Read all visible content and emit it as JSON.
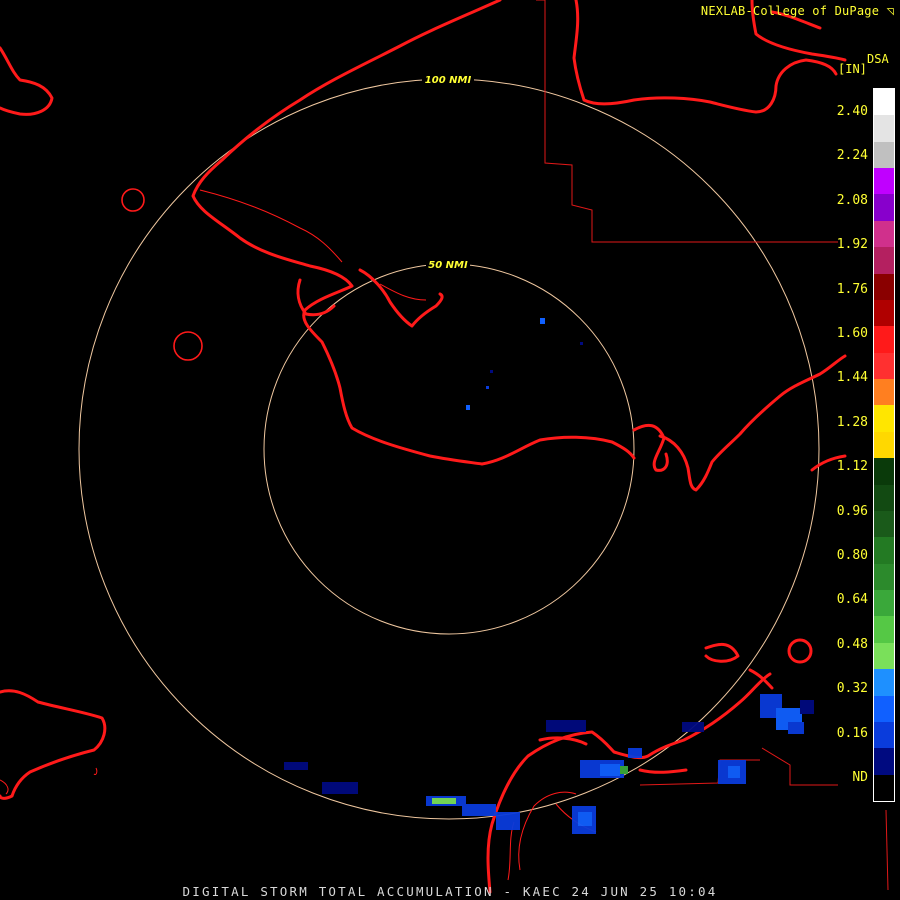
{
  "header": {
    "credit": "NEXLAB-College of DuPage",
    "credit_mark": "◹"
  },
  "legend": {
    "product_code": "DSA",
    "units": "[IN]",
    "ticks": [
      "2.40",
      "2.24",
      "2.08",
      "1.92",
      "1.76",
      "1.60",
      "1.44",
      "1.28",
      "1.12",
      "0.96",
      "0.80",
      "0.64",
      "0.48",
      "0.32",
      "0.16",
      "ND"
    ],
    "colors": [
      "#ffffff",
      "#e4e4e4",
      "#c0c0c0",
      "#c000ff",
      "#8800cc",
      "#d0308c",
      "#b42060",
      "#8a0000",
      "#b00000",
      "#ff1a1a",
      "#ff3030",
      "#ff7f20",
      "#ffe600",
      "#ffd800",
      "#0a3a0a",
      "#124a12",
      "#1a5a1a",
      "#237a23",
      "#2c8a2c",
      "#3aa83a",
      "#55c845",
      "#7ae05a",
      "#1e90ff",
      "#1060ff",
      "#0a3cdc",
      "#000a80",
      "#000000"
    ]
  },
  "map": {
    "ring_labels": [
      "100 NMI",
      "50 NMI"
    ],
    "colors": {
      "boundary": "#ff1a1a",
      "range_ring": "#f0c8a0"
    }
  },
  "footer": {
    "caption": "DIGITAL STORM TOTAL ACCUMULATION - KAEC 24 JUN 25 10:04"
  }
}
